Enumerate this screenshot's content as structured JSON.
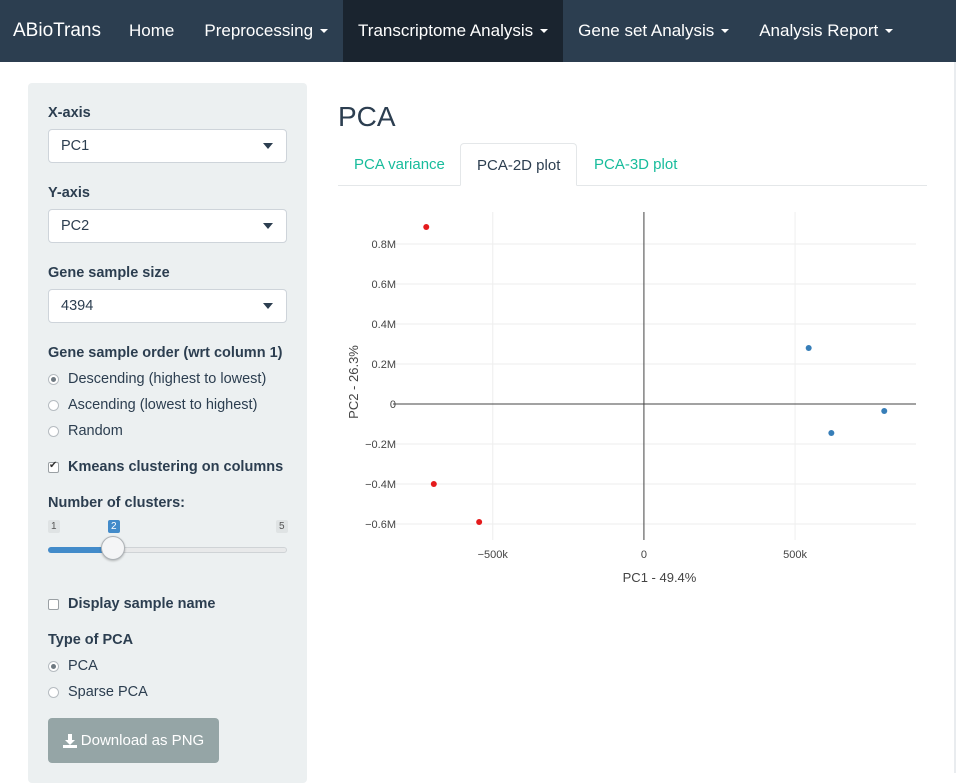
{
  "nav": {
    "brand": "ABioTrans",
    "items": [
      {
        "label": "Home",
        "dropdown": false,
        "active": false
      },
      {
        "label": "Preprocessing",
        "dropdown": true,
        "active": false
      },
      {
        "label": "Transcriptome Analysis",
        "dropdown": true,
        "active": true
      },
      {
        "label": "Gene set Analysis",
        "dropdown": true,
        "active": false
      },
      {
        "label": "Analysis Report",
        "dropdown": true,
        "active": false
      }
    ]
  },
  "sidebar": {
    "xaxis_label": "X-axis",
    "xaxis_value": "PC1",
    "yaxis_label": "Y-axis",
    "yaxis_value": "PC2",
    "sample_size_label": "Gene sample size",
    "sample_size_value": "4394",
    "order_label": "Gene sample order (wrt column 1)",
    "order_options": [
      {
        "label": "Descending (highest to lowest)",
        "selected": true
      },
      {
        "label": "Ascending (lowest to highest)",
        "selected": false
      },
      {
        "label": "Random",
        "selected": false
      }
    ],
    "kmeans_label": "Kmeans clustering on columns",
    "kmeans_checked": true,
    "clusters_label": "Number of clusters:",
    "clusters_min": "1",
    "clusters_value": "2",
    "clusters_max": "5",
    "display_name_label": "Display sample name",
    "display_name_checked": false,
    "pca_type_label": "Type of PCA",
    "pca_type_options": [
      {
        "label": "PCA",
        "selected": true
      },
      {
        "label": "Sparse PCA",
        "selected": false
      }
    ],
    "download_label": "Download as PNG"
  },
  "main": {
    "title": "PCA",
    "tabs": [
      {
        "label": "PCA variance",
        "active": false
      },
      {
        "label": "PCA-2D plot",
        "active": true
      },
      {
        "label": "PCA-3D plot",
        "active": false
      }
    ]
  },
  "chart_data": {
    "type": "scatter",
    "xlabel": "PC1 - 49.4%",
    "ylabel": "PC2 - 26.3%",
    "xlim": [
      -830000,
      900000
    ],
    "ylim": [
      -0.68,
      0.96
    ],
    "x_ticks": [
      {
        "v": -500000,
        "label": "−500k"
      },
      {
        "v": 0,
        "label": "0"
      },
      {
        "v": 500000,
        "label": "500k"
      }
    ],
    "y_ticks": [
      {
        "v": -0.6,
        "label": "−0.6M"
      },
      {
        "v": -0.4,
        "label": "−0.4M"
      },
      {
        "v": -0.2,
        "label": "−0.2M"
      },
      {
        "v": 0,
        "label": "0"
      },
      {
        "v": 0.2,
        "label": "0.2M"
      },
      {
        "v": 0.4,
        "label": "0.4M"
      },
      {
        "v": 0.6,
        "label": "0.6M"
      },
      {
        "v": 0.8,
        "label": "0.8M"
      }
    ],
    "grid": true,
    "series": [
      {
        "color": "#e41a1c",
        "points": [
          [
            -720000,
            0.885
          ],
          [
            -695000,
            -0.4
          ],
          [
            -545000,
            -0.59
          ]
        ]
      },
      {
        "color": "#377eb8",
        "points": [
          [
            545000,
            0.28
          ],
          [
            620000,
            -0.145
          ],
          [
            795000,
            -0.035
          ]
        ]
      }
    ]
  }
}
